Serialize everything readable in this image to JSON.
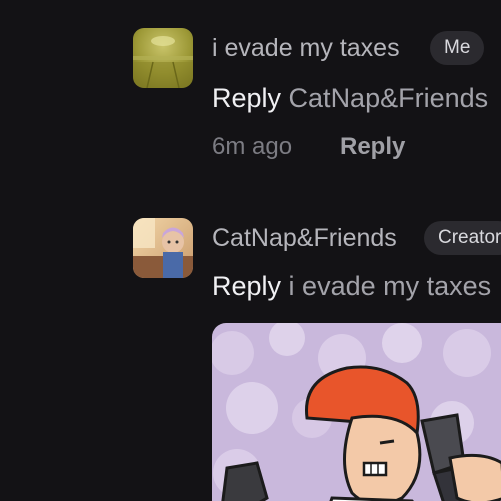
{
  "comments": [
    {
      "author": "i evade my taxes",
      "badge": "Me",
      "reply_word": "Reply",
      "reply_target": "CatNap&Friends",
      "time": "6m ago",
      "reply_action": "Reply",
      "avatar_icon": "yellow-room-avatar"
    },
    {
      "author": "CatNap&Friends",
      "badge": "Creator",
      "reply_word": "Reply",
      "reply_target": "i evade my taxes",
      "avatar_icon": "cartoon-character-avatar",
      "attachment_icon": "orange-haired-cartoon-with-gun-image"
    }
  ],
  "colors": {
    "background": "#131215",
    "primary_text": "#f0f0f3",
    "secondary_text": "#a3a3aa",
    "badge_background": "#2b2a2f"
  }
}
